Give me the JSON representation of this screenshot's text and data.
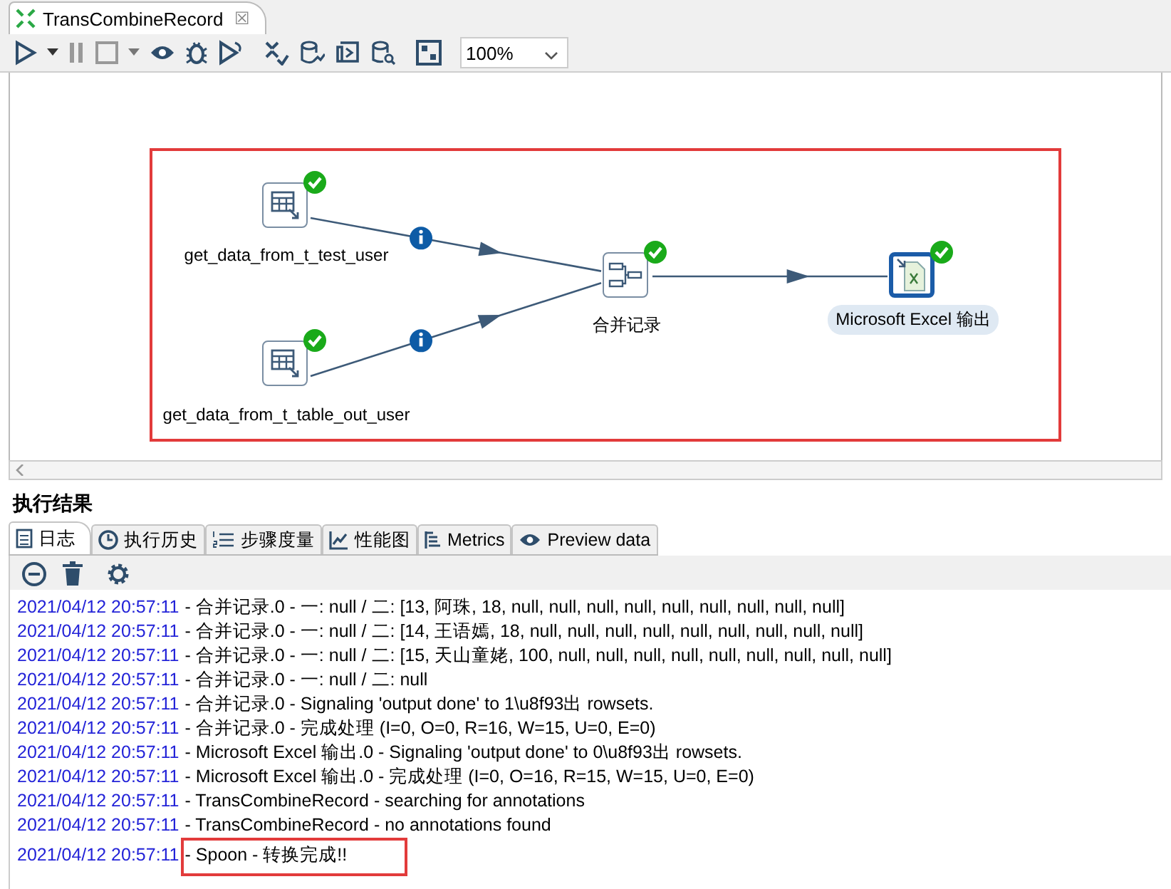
{
  "editor_tab": {
    "title": "TransCombineRecord",
    "close": "☒"
  },
  "toolbar": {
    "zoom": "100%"
  },
  "canvas": {
    "highlighted": true,
    "nodes": [
      {
        "kind": "table_input",
        "label": "get_data_from_t_test_user",
        "ok": true,
        "selected": false
      },
      {
        "kind": "table_input",
        "label": "get_data_from_t_table_out_user",
        "ok": true,
        "selected": false
      },
      {
        "kind": "merge",
        "label": "合并记录",
        "ok": true,
        "selected": false
      },
      {
        "kind": "excel_output",
        "label": "Microsoft Excel 输出",
        "ok": true,
        "selected": true
      }
    ],
    "hops": [
      {
        "info": true
      },
      {
        "info": true
      },
      {
        "info": false
      }
    ]
  },
  "results": {
    "title": "执行结果",
    "tabs": [
      {
        "label": "日志",
        "selected": true
      },
      {
        "label": "执行历史",
        "selected": false
      },
      {
        "label": "步骤度量",
        "selected": false
      },
      {
        "label": "性能图",
        "selected": false
      },
      {
        "label": "Metrics",
        "selected": false
      },
      {
        "label": "Preview data",
        "selected": false
      }
    ],
    "log": [
      {
        "time": "2021/04/12 20:57:11",
        "message": "- 合并记录.0 - 一: null / 二: [13, 阿珠, 18, null, null, null, null, null, null, null, null, null]",
        "highlighted": false
      },
      {
        "time": "2021/04/12 20:57:11",
        "message": "- 合并记录.0 - 一: null / 二: [14, 王语嫣, 18, null, null, null, null, null, null, null, null, null]",
        "highlighted": false
      },
      {
        "time": "2021/04/12 20:57:11",
        "message": "- 合并记录.0 - 一: null / 二: [15, 天山童姥, 100, null, null, null, null, null, null, null, null, null]",
        "highlighted": false
      },
      {
        "time": "2021/04/12 20:57:11",
        "message": "- 合并记录.0 - 一: null / 二: null",
        "highlighted": false
      },
      {
        "time": "2021/04/12 20:57:11",
        "message": "- 合并记录.0 - Signaling 'output done' to 1\\u8f93出 rowsets.",
        "highlighted": false
      },
      {
        "time": "2021/04/12 20:57:11",
        "message": "- 合并记录.0 - 完成处理 (I=0, O=0, R=16, W=15, U=0, E=0)",
        "highlighted": false
      },
      {
        "time": "2021/04/12 20:57:11",
        "message": "- Microsoft Excel 输出.0 - Signaling 'output done' to 0\\u8f93出 rowsets.",
        "highlighted": false
      },
      {
        "time": "2021/04/12 20:57:11",
        "message": "- Microsoft Excel 输出.0 - 完成处理 (I=0, O=16, R=15, W=15, U=0, E=0)",
        "highlighted": false
      },
      {
        "time": "2021/04/12 20:57:11",
        "message": "- TransCombineRecord - searching for annotations",
        "highlighted": false
      },
      {
        "time": "2021/04/12 20:57:11",
        "message": "- TransCombineRecord - no annotations found",
        "highlighted": false
      },
      {
        "time": "2021/04/12 20:57:11",
        "message": "- Spoon - 转换完成!!",
        "highlighted": true
      }
    ]
  }
}
